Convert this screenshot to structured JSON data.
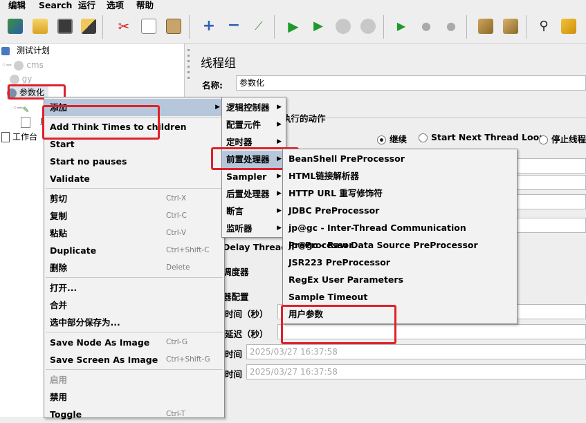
{
  "menubar": {
    "items": [
      "编辑",
      "Search",
      "运行",
      "选项",
      "帮助"
    ]
  },
  "toolbar": {
    "icons": [
      "template-icon",
      "open-icon",
      "save-icon",
      "edit-icon",
      "cut-icon",
      "copy-icon",
      "paste-icon",
      "expand-icon",
      "collapse-icon",
      "toggle-icon",
      "start-icon",
      "start-no-pauses-icon",
      "stop-icon",
      "shutdown-icon",
      "remote-start-icon",
      "remote-stop-icon",
      "remote-shutdown-icon",
      "clear-icon",
      "clear-all-icon",
      "search-icon",
      "reset-search-icon"
    ]
  },
  "tree": {
    "items": [
      {
        "label": "测试计划",
        "muted": false
      },
      {
        "label": "cms",
        "muted": true
      },
      {
        "label": "gy",
        "muted": true
      },
      {
        "label": "参数化",
        "muted": false
      },
      {
        "label": "用",
        "muted": false
      },
      {
        "label": "工作台",
        "muted": false
      }
    ]
  },
  "panel": {
    "title": "线程组",
    "name_label": "名称:",
    "name_value": "参数化",
    "error_action_suffix": "执行的动作",
    "radio_continue": "继续",
    "radio_next_loop": "Start Next Thread Loop",
    "radio_stop_thread": "停止线程",
    "delay_thread_partial": "Delay Thread c",
    "scheduler_partial": "调度器",
    "scheduler_config_partial": "器配置",
    "duration_label_partial": "时间（秒）",
    "startup_delay_label_partial": "延迟（秒）",
    "start_time_label_partial": "时间",
    "start_time_value": "2025/03/27 16:37:58",
    "end_time_label_partial": "时间",
    "end_time_value": "2025/03/27 16:37:58"
  },
  "context_menu": {
    "items": [
      {
        "label": "添加",
        "submenu": true,
        "highlight": true
      },
      {
        "label": "Add Think Times to children"
      },
      {
        "label": "Start"
      },
      {
        "label": "Start no pauses"
      },
      {
        "label": "Validate"
      },
      {
        "label": "剪切",
        "shortcut": "Ctrl-X"
      },
      {
        "label": "复制",
        "shortcut": "Ctrl-C"
      },
      {
        "label": "粘贴",
        "shortcut": "Ctrl-V"
      },
      {
        "label": "Duplicate",
        "shortcut": "Ctrl+Shift-C"
      },
      {
        "label": "删除",
        "shortcut": "Delete"
      },
      {
        "label": "打开..."
      },
      {
        "label": "合并"
      },
      {
        "label": "选中部分保存为..."
      },
      {
        "label": "Save Node As Image",
        "shortcut": "Ctrl-G"
      },
      {
        "label": "Save Screen As Image",
        "shortcut": "Ctrl+Shift-G"
      },
      {
        "label": "启用",
        "disabled": true
      },
      {
        "label": "禁用"
      },
      {
        "label": "Toggle",
        "shortcut": "Ctrl-T"
      }
    ]
  },
  "add_submenu": {
    "items": [
      {
        "label": "逻辑控制器"
      },
      {
        "label": "配置元件"
      },
      {
        "label": "定时器"
      },
      {
        "label": "前置处理器",
        "highlight": true
      },
      {
        "label": "Sampler"
      },
      {
        "label": "后置处理器"
      },
      {
        "label": "断言"
      },
      {
        "label": "监听器"
      }
    ]
  },
  "preprocessor_submenu": {
    "items": [
      "BeanShell PreProcessor",
      "HTML链接解析器",
      "HTTP URL 重写修饰符",
      "JDBC PreProcessor",
      "jp@gc - Inter-Thread Communication PreProcessor",
      "jp@gc - Raw Data Source PreProcessor",
      "JSR223 PreProcessor",
      "RegEx User Parameters",
      "Sample Timeout",
      "用户参数"
    ]
  },
  "colors": {
    "highlight": "#b6c7dc",
    "annotation_red": "#e0202a",
    "menu_bg": "#f2f2f2"
  }
}
